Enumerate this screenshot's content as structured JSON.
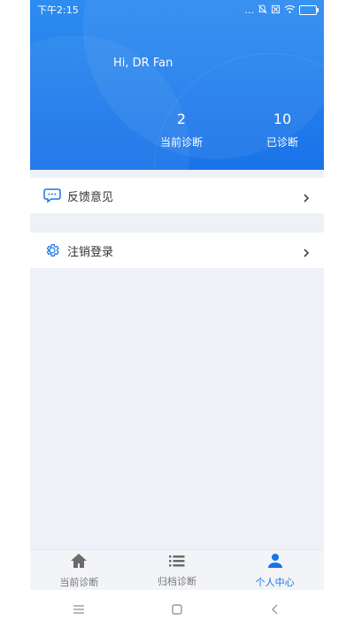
{
  "status_bar": {
    "time": "下午2:15",
    "dots": "...",
    "icons": [
      "bell-off-icon",
      "sim-off-icon",
      "wifi-icon",
      "battery-charging-icon"
    ]
  },
  "header": {
    "greeting": "Hi, DR Fan",
    "stats": [
      {
        "value": "2",
        "label": "当前诊断"
      },
      {
        "value": "10",
        "label": "已诊断"
      }
    ],
    "accent_color": "#1a73e8"
  },
  "menu": [
    {
      "label": "反馈意见",
      "icon": "chat-bubble-icon"
    },
    {
      "label": "注销登录",
      "icon": "gear-icon"
    }
  ],
  "tabbar": {
    "tabs": [
      {
        "label": "当前诊断",
        "icon": "home-icon",
        "active": false
      },
      {
        "label": "归档诊断",
        "icon": "list-icon",
        "active": false
      },
      {
        "label": "个人中心",
        "icon": "person-icon",
        "active": true
      }
    ]
  },
  "system_nav": {
    "buttons": [
      "menu-icon",
      "home-square-icon",
      "back-icon"
    ]
  }
}
